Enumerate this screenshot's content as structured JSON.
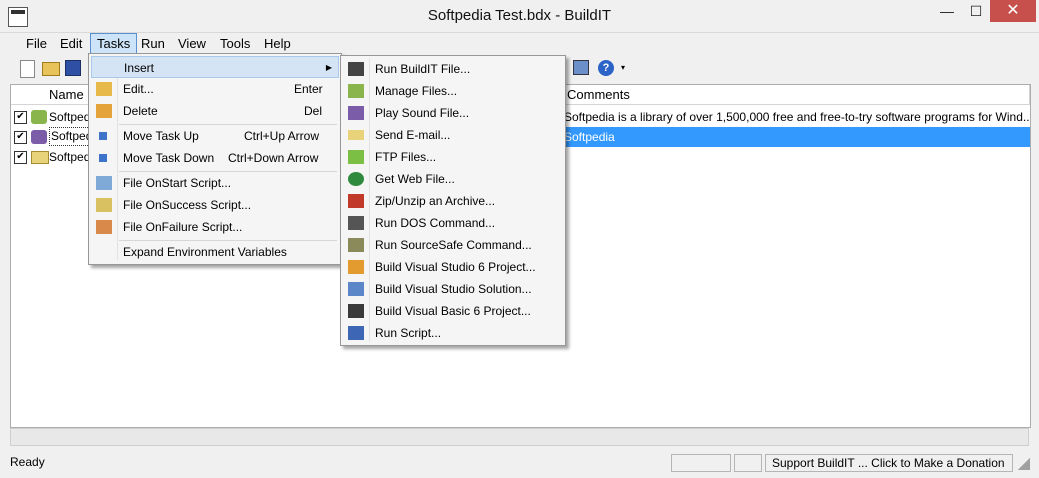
{
  "window": {
    "title": "Softpedia Test.bdx - BuildIT",
    "minimize": "—",
    "maximize": "☐",
    "close": "✕"
  },
  "menubar": [
    "File",
    "Edit",
    "Tasks",
    "Run",
    "View",
    "Tools",
    "Help"
  ],
  "list": {
    "headers": [
      "Name",
      "Comments"
    ],
    "rows": [
      {
        "name": "Softped",
        "comment": "Softpedia is a library of over 1,500,000 free and free-to-try software programs for Wind...",
        "checked": "✔"
      },
      {
        "name": "Softped",
        "comment": "Softpedia",
        "checked": "✔"
      },
      {
        "name": "Softped",
        "comment": "",
        "checked": "✔"
      }
    ]
  },
  "tasks_menu": {
    "items": [
      {
        "label": "Insert",
        "shortcut": ""
      },
      {
        "label": "Edit...",
        "shortcut": "Enter"
      },
      {
        "label": "Delete",
        "shortcut": "Del"
      },
      {
        "label": "Move Task Up",
        "shortcut": "Ctrl+Up Arrow"
      },
      {
        "label": "Move Task Down",
        "shortcut": "Ctrl+Down Arrow"
      },
      {
        "label": "File OnStart Script...",
        "shortcut": ""
      },
      {
        "label": "File OnSuccess Script...",
        "shortcut": ""
      },
      {
        "label": "File OnFailure Script...",
        "shortcut": ""
      },
      {
        "label": "Expand Environment Variables",
        "shortcut": ""
      }
    ],
    "submenu_arrow": "▶"
  },
  "insert_submenu": [
    "Run BuildIT File...",
    "Manage Files...",
    "Play Sound File...",
    "Send E-mail...",
    "FTP Files...",
    "Get Web File...",
    "Zip/Unzip an Archive...",
    "Run DOS Command...",
    "Run SourceSafe Command...",
    "Build Visual Studio 6 Project...",
    "Build Visual Studio Solution...",
    "Build Visual Basic 6 Project...",
    "Run Script..."
  ],
  "statusbar": {
    "left": "Ready",
    "donate": "Support BuildIT ... Click to Make a Donation"
  },
  "toolbar": {
    "help_glyph": "?"
  },
  "colors": {
    "selection": "#3399ff",
    "menu_highlight": "#d5e4f5",
    "close": "#c7504c"
  }
}
